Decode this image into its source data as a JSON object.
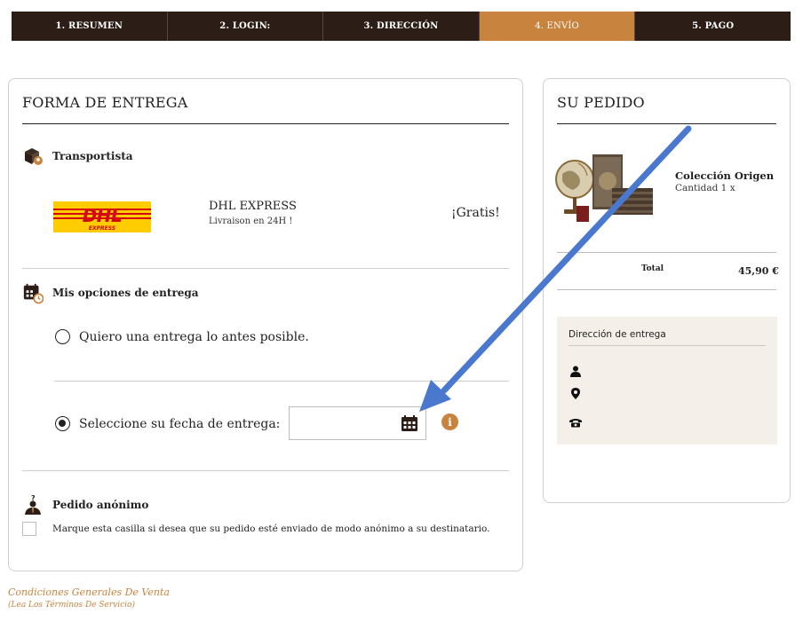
{
  "steps": [
    {
      "label": "1. RESUMEN"
    },
    {
      "label": "2. LOGIN:"
    },
    {
      "label": "3. DIRECCIÓN"
    },
    {
      "label": "4. ENVÍO"
    },
    {
      "label": "5. PAGO"
    }
  ],
  "active_step": 3,
  "delivery": {
    "title": "FORMA DE ENTREGA",
    "carrier_section": "Transportista",
    "carrier": {
      "logo_text": "DHL",
      "logo_subtext": "EXPRESS",
      "name": "DHL EXPRESS",
      "description": "Livraison en 24H !",
      "price": "¡Gratis!"
    },
    "options_section": "Mis opciones de entrega",
    "option_asap": "Quiero una entrega lo antes posible.",
    "option_date": "Seleccione su fecha de entrega:",
    "date_value": "",
    "selected_option": "date",
    "anonymous_section": "Pedido anónimo",
    "anonymous_label": "Marque esta casilla si desea que su pedido esté enviado de modo anónimo a su destinatario.",
    "anonymous_checked": false
  },
  "order": {
    "title": "SU PEDIDO",
    "product_name": "Colección Origen",
    "product_qty": "Cantidad 1 x",
    "total_label": "Total",
    "total_value": "45,90 €",
    "address_title": "Dirección de entrega"
  },
  "footer": {
    "terms": "Condiciones Generales De Venta",
    "terms_sub": "(Lea Los Términos De Servicio)"
  },
  "colors": {
    "dark": "#2c1e17",
    "accent": "#c8843f",
    "annotation_arrow": "#4a78cf"
  },
  "icons": [
    "transport-box-icon",
    "calendar-options-icon",
    "calendar-icon",
    "info-icon",
    "anonymous-person-icon",
    "person-icon",
    "location-pin-icon",
    "phone-icon"
  ]
}
